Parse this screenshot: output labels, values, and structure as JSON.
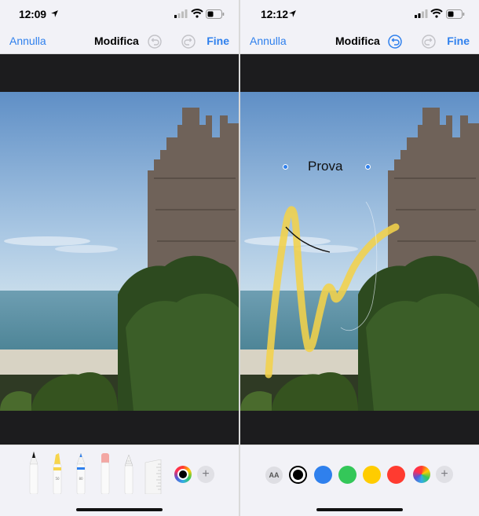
{
  "left": {
    "status_time": "12:09",
    "nav": {
      "cancel": "Annulla",
      "title": "Modifica",
      "done": "Fine",
      "undo_enabled": false,
      "redo_enabled": false
    },
    "tools": [
      {
        "name": "pen",
        "label": ""
      },
      {
        "name": "marker",
        "label": "50"
      },
      {
        "name": "pencil",
        "label": "80"
      },
      {
        "name": "eraser",
        "label": ""
      },
      {
        "name": "lasso",
        "label": ""
      },
      {
        "name": "ruler",
        "label": ""
      }
    ]
  },
  "right": {
    "status_time": "12:12",
    "nav": {
      "cancel": "Annulla",
      "title": "Modifica",
      "done": "Fine",
      "undo_enabled": true,
      "redo_enabled": false
    },
    "text_annotation": "Prova",
    "font_button": "AA",
    "colors": [
      "#000000",
      "#2f80ed",
      "#34c759",
      "#ffcc00",
      "#ff3b30"
    ]
  },
  "accent_color": "#2f80ed",
  "marker_color": "#f2d24a"
}
